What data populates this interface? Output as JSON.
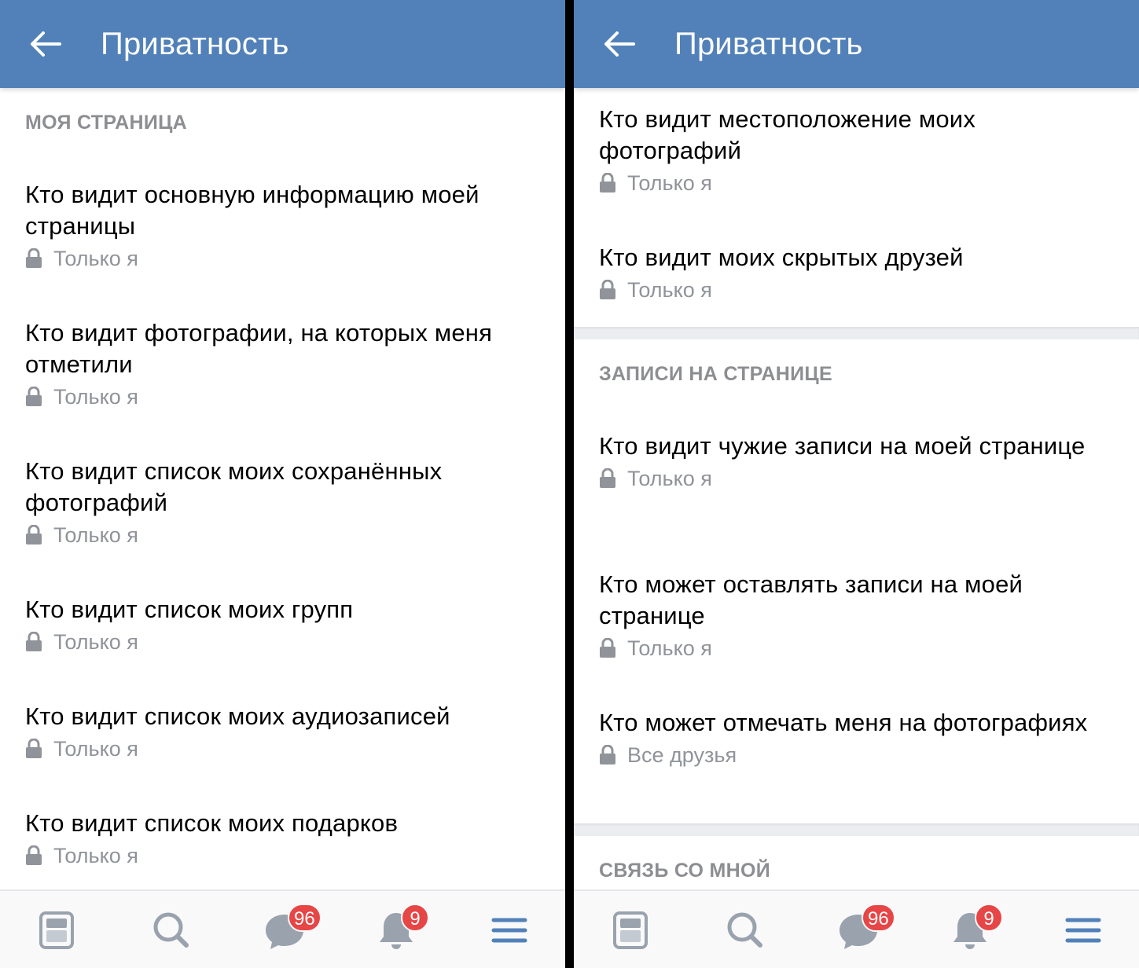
{
  "left": {
    "header": {
      "title": "Приватность"
    },
    "section_title": "МОЯ СТРАНИЦА",
    "items": [
      {
        "title": "Кто видит основную информацию моей страницы",
        "value": "Только я"
      },
      {
        "title": "Кто видит фотографии, на которых меня отметили",
        "value": "Только я"
      },
      {
        "title": "Кто видит список моих сохранённых фотографий",
        "value": "Только я"
      },
      {
        "title": "Кто видит список моих групп",
        "value": "Только я"
      },
      {
        "title": "Кто видит список моих аудиозаписей",
        "value": "Только я"
      },
      {
        "title": "Кто видит список моих подарков",
        "value": "Только я"
      }
    ]
  },
  "right": {
    "header": {
      "title": "Приватность"
    },
    "items_top": [
      {
        "title": "Кто видит местоположение моих фотографий",
        "value": "Только я"
      },
      {
        "title": "Кто видит моих скрытых друзей",
        "value": "Только я"
      }
    ],
    "section_posts": "ЗАПИСИ НА СТРАНИЦЕ",
    "items_posts": [
      {
        "title": "Кто видит чужие записи на моей странице",
        "value": "Только я"
      },
      {
        "title": "Кто может оставлять записи на моей странице",
        "value": "Только я"
      },
      {
        "title": "Кто может отмечать меня на фотографиях",
        "value": "Все друзья"
      }
    ],
    "section_contact": "СВЯЗЬ СО МНОЙ"
  },
  "tabbar": {
    "messages_badge": "96",
    "notifications_badge": "9"
  },
  "colors": {
    "header": "#5181b8",
    "badge": "#e64646",
    "icon": "#99a2ad",
    "menu_icon": "#5181b8"
  },
  "icons": [
    "back-arrow-icon",
    "lock-icon",
    "news-icon",
    "search-icon",
    "messages-icon",
    "bell-icon",
    "menu-icon"
  ]
}
